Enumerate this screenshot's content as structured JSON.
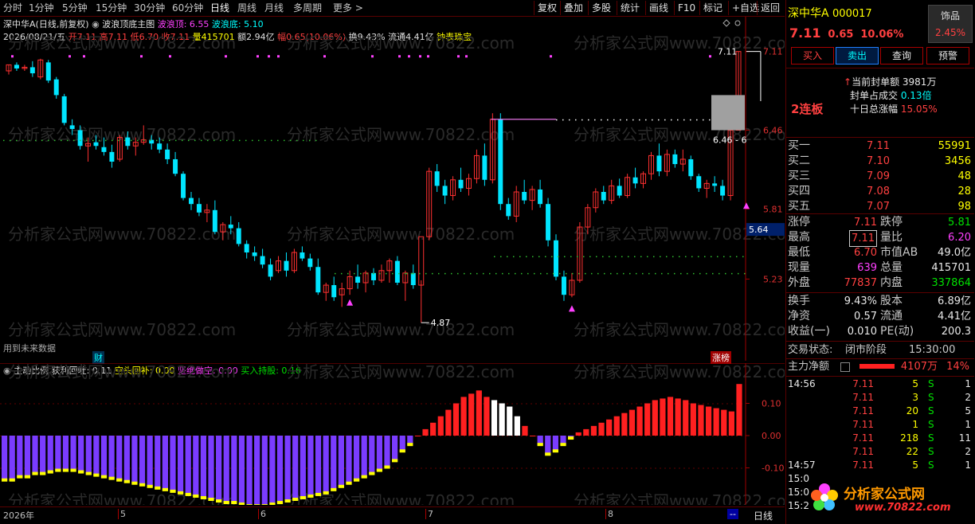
{
  "toolbar": {
    "periods": [
      "分时",
      "1分钟",
      "5分钟",
      "15分钟",
      "30分钟",
      "60分钟",
      "日线",
      "周线",
      "月线",
      "多周期",
      "更多 >"
    ],
    "active_period": "日线",
    "right_buttons": [
      "复权",
      "叠加",
      "多股",
      "统计",
      "画线",
      "F10",
      "标记",
      "+自选",
      "返回"
    ]
  },
  "main_header": {
    "stock_name": "深中华A(日线,前复权)",
    "indicator_name": "波浪顶底主图",
    "top_label": "波浪顶: 6.55",
    "bottom_label": "波浪底: 5.10"
  },
  "ohlc_line": {
    "date": "2026/08/21/五",
    "open": "开7.11",
    "high": "高7.11",
    "low": "低6.70",
    "close": "收7.11",
    "volume": "量415701",
    "amount": "额2.94亿",
    "change": "幅0.65(10.06%)",
    "turnover": "换9.43%",
    "float": "流通4.41亿",
    "tag": "钟表珠宝"
  },
  "main_chart": {
    "price_labels": [
      "7.11",
      "6.46",
      "5.81",
      "5.23"
    ],
    "current_price_tag": "5.64",
    "high_annotation": "7.11",
    "low_annotation": "4.87",
    "box_annotation": "6.46 - 6",
    "future_note": "用到未来数据",
    "badge_cai": "财",
    "badge_zhangbang": "涨榜",
    "watermark": "分析家公式网www.70822.com",
    "colors": {
      "up": "#ff3030",
      "down": "#00e5ff",
      "support": "#ffffff",
      "magenta": "#ff40ff",
      "green_dots": "#00c000"
    }
  },
  "chart_data": [
    {
      "type": "candlestick",
      "title": "波浪顶底主图",
      "ylim": [
        4.7,
        7.2
      ],
      "y_ticks": [
        7.11,
        6.46,
        5.81,
        5.23
      ],
      "candles": [
        [
          6.95,
          7.0,
          6.92,
          7.0
        ],
        [
          7.0,
          7.02,
          6.95,
          6.97
        ],
        [
          6.97,
          7.0,
          6.95,
          6.98
        ],
        [
          6.98,
          7.03,
          6.9,
          6.93
        ],
        [
          6.9,
          7.05,
          6.88,
          7.04
        ],
        [
          7.02,
          7.04,
          6.85,
          6.87
        ],
        [
          6.88,
          6.9,
          6.72,
          6.75
        ],
        [
          6.74,
          6.76,
          6.5,
          6.52
        ],
        [
          6.5,
          6.55,
          6.42,
          6.47
        ],
        [
          6.46,
          6.5,
          6.3,
          6.33
        ],
        [
          6.33,
          6.4,
          6.2,
          6.35
        ],
        [
          6.36,
          6.42,
          6.3,
          6.33
        ],
        [
          6.32,
          6.4,
          6.25,
          6.28
        ],
        [
          6.28,
          6.34,
          6.15,
          6.2
        ],
        [
          6.22,
          6.42,
          6.2,
          6.4
        ],
        [
          6.4,
          6.45,
          6.3,
          6.33
        ],
        [
          6.33,
          6.4,
          6.25,
          6.36
        ],
        [
          6.36,
          6.5,
          6.34,
          6.38
        ],
        [
          6.38,
          6.42,
          6.3,
          6.35
        ],
        [
          6.35,
          6.4,
          6.27,
          6.3
        ],
        [
          6.3,
          6.35,
          6.18,
          6.22
        ],
        [
          6.22,
          6.28,
          6.08,
          6.1
        ],
        [
          6.1,
          6.12,
          5.88,
          5.9
        ],
        [
          5.9,
          5.95,
          5.8,
          5.85
        ],
        [
          5.85,
          5.9,
          5.75,
          5.78
        ],
        [
          5.78,
          5.85,
          5.7,
          5.8
        ],
        [
          5.8,
          5.88,
          5.6,
          5.62
        ],
        [
          5.62,
          5.7,
          5.55,
          5.68
        ],
        [
          5.68,
          5.75,
          5.6,
          5.65
        ],
        [
          5.65,
          5.7,
          5.5,
          5.52
        ],
        [
          5.52,
          5.55,
          5.4,
          5.45
        ],
        [
          5.45,
          5.5,
          5.38,
          5.42
        ],
        [
          5.42,
          5.48,
          5.32,
          5.35
        ],
        [
          5.35,
          5.4,
          5.22,
          5.25
        ],
        [
          5.3,
          5.42,
          5.28,
          5.38
        ],
        [
          5.38,
          5.45,
          5.25,
          5.3
        ],
        [
          5.3,
          5.48,
          5.28,
          5.45
        ],
        [
          5.45,
          5.5,
          5.38,
          5.4
        ],
        [
          5.4,
          5.44,
          5.3,
          5.33
        ],
        [
          5.33,
          5.4,
          5.1,
          5.12
        ],
        [
          5.12,
          5.2,
          5.05,
          5.18
        ],
        [
          5.18,
          5.25,
          5.05,
          5.08
        ],
        [
          5.1,
          5.2,
          5.0,
          5.15
        ],
        [
          5.15,
          5.3,
          5.1,
          5.25
        ],
        [
          5.25,
          5.35,
          5.15,
          5.2
        ],
        [
          5.2,
          5.3,
          5.12,
          5.28
        ],
        [
          5.28,
          5.32,
          5.18,
          5.22
        ],
        [
          5.22,
          5.35,
          5.2,
          5.3
        ],
        [
          5.3,
          5.4,
          5.2,
          5.38
        ],
        [
          5.38,
          5.42,
          5.18,
          5.2
        ],
        [
          5.2,
          5.3,
          5.05,
          5.28
        ],
        [
          5.28,
          5.35,
          5.15,
          5.18
        ],
        [
          5.18,
          5.22,
          4.87,
          5.58
        ],
        [
          5.58,
          6.15,
          5.55,
          6.12
        ],
        [
          6.12,
          6.18,
          5.95,
          6.0
        ],
        [
          6.0,
          6.05,
          5.85,
          5.92
        ],
        [
          5.92,
          6.08,
          5.88,
          6.05
        ],
        [
          6.05,
          6.15,
          5.95,
          5.98
        ],
        [
          5.98,
          6.1,
          5.92,
          6.06
        ],
        [
          6.06,
          6.3,
          6.02,
          6.25
        ],
        [
          6.25,
          6.35,
          6.0,
          6.05
        ],
        [
          6.05,
          6.6,
          6.02,
          6.55
        ],
        [
          6.55,
          6.6,
          5.8,
          5.85
        ],
        [
          5.85,
          5.9,
          5.72,
          5.75
        ],
        [
          5.75,
          6.0,
          5.7,
          5.95
        ],
        [
          5.95,
          6.05,
          5.85,
          5.88
        ],
        [
          5.88,
          6.0,
          5.8,
          5.97
        ],
        [
          5.97,
          6.05,
          5.82,
          5.85
        ],
        [
          5.85,
          5.9,
          5.5,
          5.55
        ],
        [
          5.55,
          5.6,
          5.22,
          5.25
        ],
        [
          5.25,
          5.3,
          5.05,
          5.1
        ],
        [
          5.1,
          5.28,
          5.08,
          5.22
        ],
        [
          5.22,
          5.7,
          5.2,
          5.66
        ],
        [
          5.66,
          5.85,
          5.6,
          5.82
        ],
        [
          5.82,
          5.98,
          5.78,
          5.95
        ],
        [
          5.95,
          6.0,
          5.85,
          5.88
        ],
        [
          5.88,
          6.05,
          5.85,
          6.0
        ],
        [
          6.0,
          6.06,
          5.9,
          5.92
        ],
        [
          5.92,
          6.1,
          5.9,
          6.07
        ],
        [
          6.07,
          6.15,
          5.98,
          6.02
        ],
        [
          6.02,
          6.12,
          5.98,
          6.1
        ],
        [
          6.1,
          6.28,
          6.05,
          6.25
        ],
        [
          6.25,
          6.35,
          6.08,
          6.12
        ],
        [
          6.12,
          6.3,
          6.08,
          6.26
        ],
        [
          6.26,
          6.3,
          6.15,
          6.18
        ],
        [
          6.18,
          6.3,
          6.12,
          6.22
        ],
        [
          6.22,
          6.25,
          6.05,
          6.08
        ],
        [
          6.08,
          6.1,
          5.95,
          5.98
        ],
        [
          5.98,
          6.05,
          5.9,
          6.02
        ],
        [
          6.02,
          6.08,
          5.95,
          6.0
        ],
        [
          6.0,
          6.05,
          5.88,
          5.92
        ],
        [
          5.92,
          6.46,
          5.88,
          6.46
        ],
        [
          6.46,
          7.11,
          6.7,
          7.11
        ]
      ]
    },
    {
      "type": "bar",
      "title": "主动比例",
      "series_labels": [
        "获利回吐: 0.11",
        "空头回补: 0.00",
        "坚绝做空: 0.00",
        "买入持股: 0.16"
      ],
      "ylim": [
        -0.2,
        0.2
      ],
      "y_ticks": [
        0.1,
        0.0,
        -0.1
      ],
      "values": [
        -0.14,
        -0.14,
        -0.13,
        -0.13,
        -0.12,
        -0.12,
        -0.115,
        -0.11,
        -0.11,
        -0.11,
        -0.115,
        -0.12,
        -0.125,
        -0.13,
        -0.135,
        -0.14,
        -0.145,
        -0.15,
        -0.155,
        -0.16,
        -0.165,
        -0.17,
        -0.175,
        -0.18,
        -0.185,
        -0.19,
        -0.195,
        -0.2,
        -0.205,
        -0.21,
        -0.21,
        -0.215,
        -0.22,
        -0.22,
        -0.22,
        -0.215,
        -0.21,
        -0.205,
        -0.2,
        -0.195,
        -0.19,
        -0.185,
        -0.18,
        -0.17,
        -0.16,
        -0.15,
        -0.14,
        -0.13,
        -0.12,
        -0.11,
        -0.1,
        -0.08,
        -0.05,
        -0.03,
        0.0,
        0.02,
        0.04,
        0.06,
        0.08,
        0.1,
        0.12,
        0.13,
        0.14,
        0.12,
        0.11,
        0.1,
        0.09,
        0.06,
        0.03,
        0.0,
        -0.03,
        -0.06,
        -0.05,
        -0.03,
        -0.01,
        0.01,
        0.02,
        0.03,
        0.04,
        0.05,
        0.06,
        0.07,
        0.08,
        0.09,
        0.1,
        0.11,
        0.115,
        0.12,
        0.115,
        0.11,
        0.1,
        0.095,
        0.09,
        0.085,
        0.08,
        0.075,
        0.16
      ],
      "colors": {
        "positive": "#ff2020",
        "negative": "#7a3cff",
        "bull_edge": "#ffff00",
        "weak": "#ffffff"
      }
    }
  ],
  "lower_header": {
    "name": "主动比例",
    "profit_take": "获利回吐: 0.11",
    "short_cover": "空头回补: 0.00",
    "firm_short": "坚绝做空: 0.00",
    "buy_hold": "买入持股: 0.16"
  },
  "x_axis": {
    "year_label": "2026年",
    "month_labels": [
      "5",
      "6",
      "7",
      "8"
    ],
    "period_label": "日线",
    "dash_label": "--"
  },
  "right_panel": {
    "stock_name": "深中华A",
    "stock_code": "000017",
    "sector_tag": "饰品",
    "sector_change": "2.45%",
    "price": "7.11",
    "change": "0.65",
    "change_pct": "10.06%",
    "trade_buttons": [
      "买入",
      "卖出",
      "查询",
      "预警"
    ],
    "limit_info": {
      "streak": "2连板",
      "seal_amount_label": "当前封单额",
      "seal_amount": "3981万",
      "seal_ratio_label": "封单占成交",
      "seal_ratio": "0.13倍",
      "ten_day_label": "十日总涨幅",
      "ten_day": "15.05%"
    },
    "bids": [
      {
        "label": "买一",
        "price": "7.11",
        "vol": "55991"
      },
      {
        "label": "买二",
        "price": "7.10",
        "vol": "3456"
      },
      {
        "label": "买三",
        "price": "7.09",
        "vol": "48"
      },
      {
        "label": "买四",
        "price": "7.08",
        "vol": "28"
      },
      {
        "label": "买五",
        "price": "7.07",
        "vol": "98"
      }
    ],
    "stats": [
      {
        "l1": "涨停",
        "v1": "7.11",
        "l2": "跌停",
        "v2": "5.81"
      },
      {
        "l1": "最高",
        "v1": "7.11",
        "l2": "量比",
        "v2": "6.20"
      },
      {
        "l1": "最低",
        "v1": "6.70",
        "l2": "市值AB",
        "v2": "49.0亿"
      },
      {
        "l1": "现量",
        "v1": "639",
        "l2": "总量",
        "v2": "415701"
      },
      {
        "l1": "外盘",
        "v1": "77837",
        "l2": "内盘",
        "v2": "337864"
      }
    ],
    "stats2": [
      {
        "l1": "换手",
        "v1": "9.43%",
        "l2": "股本",
        "v2": "6.89亿"
      },
      {
        "l1": "净资",
        "v1": "0.57",
        "l2": "流通",
        "v2": "4.41亿"
      },
      {
        "l1": "收益(一)",
        "v1": "0.010",
        "l2": "PE(动)",
        "v2": "200.3"
      }
    ],
    "trade_status_label": "交易状态:",
    "trade_status": "闭市阶段",
    "trade_time": "15:30:00",
    "main_net_label": "主力净额",
    "main_net_value": "4107万",
    "main_net_pct": "14%",
    "ticks": [
      {
        "time": "14:56",
        "price": "7.11",
        "vol": "5",
        "side": "S",
        "n": "1"
      },
      {
        "time": "",
        "price": "7.11",
        "vol": "3",
        "side": "S",
        "n": "2"
      },
      {
        "time": "",
        "price": "7.11",
        "vol": "20",
        "side": "S",
        "n": "5"
      },
      {
        "time": "",
        "price": "7.11",
        "vol": "1",
        "side": "S",
        "n": "1"
      },
      {
        "time": "",
        "price": "7.11",
        "vol": "218",
        "side": "S",
        "n": "11"
      },
      {
        "time": "",
        "price": "7.11",
        "vol": "22",
        "side": "S",
        "n": "2"
      },
      {
        "time": "14:57",
        "price": "7.11",
        "vol": "5",
        "side": "S",
        "n": "1"
      },
      {
        "time": "15:0",
        "price": "",
        "vol": "",
        "side": "",
        "n": ""
      },
      {
        "time": "15:0",
        "price": "",
        "vol": "",
        "side": "",
        "n": ""
      },
      {
        "time": "15:2",
        "price": "",
        "vol": "",
        "side": "",
        "n": ""
      }
    ],
    "logo_text": "分析家公式网",
    "logo_url": "www.70822.com"
  }
}
